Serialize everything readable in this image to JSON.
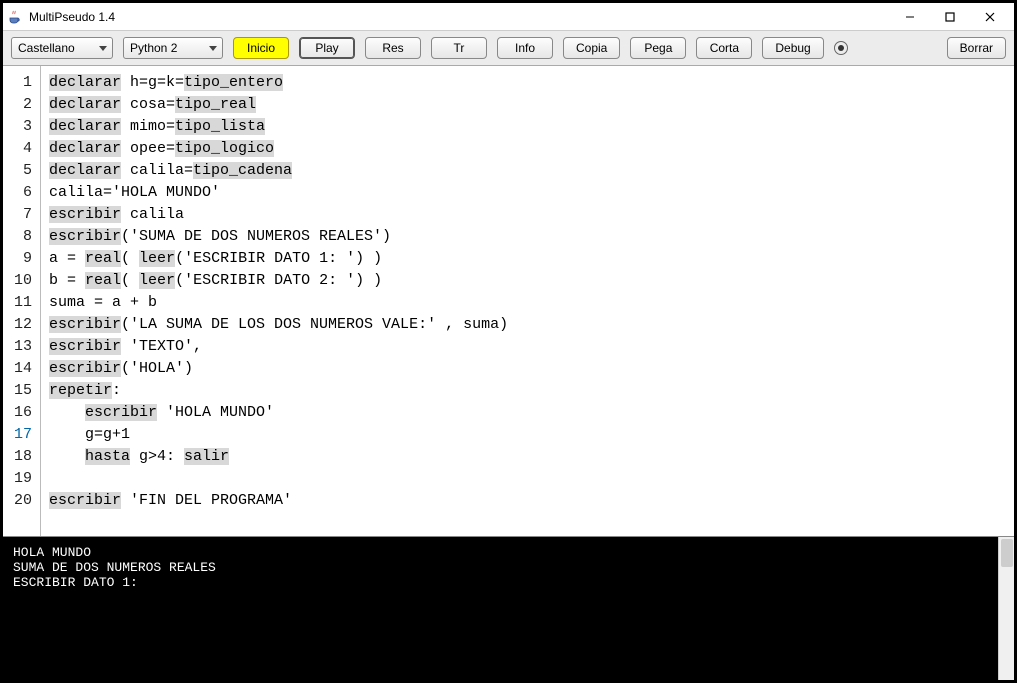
{
  "window": {
    "title": "MultiPseudo 1.4"
  },
  "toolbar": {
    "language": "Castellano",
    "python": "Python 2",
    "inicio": "Inicio",
    "play": "Play",
    "res": "Res",
    "tr": "Tr",
    "info": "Info",
    "copia": "Copia",
    "pega": "Pega",
    "corta": "Corta",
    "debug": "Debug",
    "borrar": "Borrar"
  },
  "code": {
    "lines": [
      {
        "n": 1,
        "seg": [
          {
            "t": "declarar",
            "h": 1
          },
          {
            "t": " h=g=k=",
            "h": 0
          },
          {
            "t": "tipo_entero",
            "h": 1
          }
        ]
      },
      {
        "n": 2,
        "seg": [
          {
            "t": "declarar",
            "h": 1
          },
          {
            "t": " cosa=",
            "h": 0
          },
          {
            "t": "tipo_real",
            "h": 1
          }
        ]
      },
      {
        "n": 3,
        "seg": [
          {
            "t": "declarar",
            "h": 1
          },
          {
            "t": " mimo=",
            "h": 0
          },
          {
            "t": "tipo_lista",
            "h": 1
          }
        ]
      },
      {
        "n": 4,
        "seg": [
          {
            "t": "declarar",
            "h": 1
          },
          {
            "t": " opee=",
            "h": 0
          },
          {
            "t": "tipo_logico",
            "h": 1
          }
        ]
      },
      {
        "n": 5,
        "seg": [
          {
            "t": "declarar",
            "h": 1
          },
          {
            "t": " calila=",
            "h": 0
          },
          {
            "t": "tipo_cadena",
            "h": 1
          }
        ]
      },
      {
        "n": 6,
        "seg": [
          {
            "t": "calila='HOLA MUNDO'",
            "h": 0
          }
        ]
      },
      {
        "n": 7,
        "seg": [
          {
            "t": "escribir",
            "h": 1
          },
          {
            "t": " calila",
            "h": 0
          }
        ]
      },
      {
        "n": 8,
        "seg": [
          {
            "t": "escribir",
            "h": 1
          },
          {
            "t": "('SUMA DE DOS NUMEROS REALES')",
            "h": 0
          }
        ]
      },
      {
        "n": 9,
        "seg": [
          {
            "t": "a = ",
            "h": 0
          },
          {
            "t": "real",
            "h": 1
          },
          {
            "t": "( ",
            "h": 0
          },
          {
            "t": "leer",
            "h": 1
          },
          {
            "t": "('ESCRIBIR DATO 1: ') )",
            "h": 0
          }
        ]
      },
      {
        "n": 10,
        "seg": [
          {
            "t": "b = ",
            "h": 0
          },
          {
            "t": "real",
            "h": 1
          },
          {
            "t": "( ",
            "h": 0
          },
          {
            "t": "leer",
            "h": 1
          },
          {
            "t": "('ESCRIBIR DATO 2: ') )",
            "h": 0
          }
        ]
      },
      {
        "n": 11,
        "seg": [
          {
            "t": "suma = a + b",
            "h": 0
          }
        ]
      },
      {
        "n": 12,
        "seg": [
          {
            "t": "escribir",
            "h": 1
          },
          {
            "t": "('LA SUMA DE LOS DOS NUMEROS VALE:' , suma)",
            "h": 0
          }
        ]
      },
      {
        "n": 13,
        "seg": [
          {
            "t": "escribir",
            "h": 1
          },
          {
            "t": " 'TEXTO',",
            "h": 0
          }
        ]
      },
      {
        "n": 14,
        "seg": [
          {
            "t": "escribir",
            "h": 1
          },
          {
            "t": "('HOLA')",
            "h": 0
          }
        ]
      },
      {
        "n": 15,
        "seg": [
          {
            "t": "repetir",
            "h": 1
          },
          {
            "t": ":",
            "h": 0
          }
        ]
      },
      {
        "n": 16,
        "seg": [
          {
            "t": "    ",
            "h": 0
          },
          {
            "t": "escribir",
            "h": 1
          },
          {
            "t": " 'HOLA MUNDO'",
            "h": 0
          }
        ]
      },
      {
        "n": 17,
        "cur": true,
        "seg": [
          {
            "t": "    g=g+1",
            "h": 0
          }
        ]
      },
      {
        "n": 18,
        "seg": [
          {
            "t": "    ",
            "h": 0
          },
          {
            "t": "hasta",
            "h": 1
          },
          {
            "t": " g>4: ",
            "h": 0
          },
          {
            "t": "salir",
            "h": 1
          }
        ]
      },
      {
        "n": 19,
        "seg": [
          {
            "t": "",
            "h": 0
          }
        ]
      },
      {
        "n": 20,
        "seg": [
          {
            "t": "escribir",
            "h": 1
          },
          {
            "t": " 'FIN DEL PROGRAMA'",
            "h": 0
          }
        ]
      }
    ]
  },
  "console": "HOLA MUNDO\nSUMA DE DOS NUMEROS REALES\nESCRIBIR DATO 1: "
}
